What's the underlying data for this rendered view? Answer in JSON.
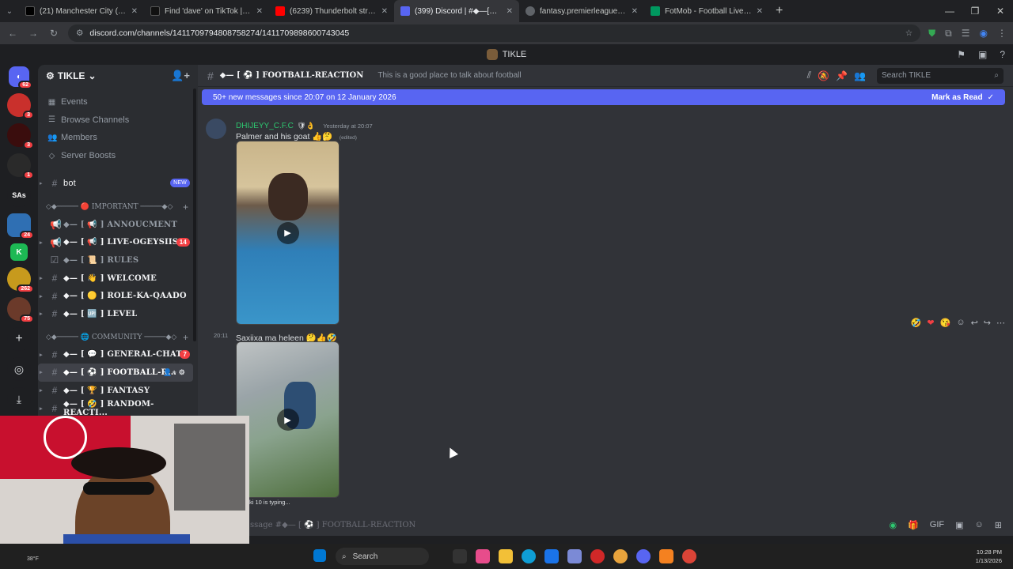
{
  "browser": {
    "tabs": [
      {
        "title": "(21) Manchester City (@ManCity...",
        "color": "#000000",
        "icon": "x-icon"
      },
      {
        "title": "Find 'dave' on TikTok | TikTok Se...",
        "color": "#111111",
        "icon": "tiktok-icon"
      },
      {
        "title": "(6239) Thunderbolt strikes seal...",
        "color": "#ff0000",
        "icon": "youtube-icon"
      },
      {
        "title": "(399) Discord | #◆—[⊛]FOOT...",
        "color": "#5865f2",
        "icon": "discord-icon"
      },
      {
        "title": "fantasy.premierleague.com",
        "color": "#37003c",
        "icon": "globe-icon"
      },
      {
        "title": "FotMob - Football Live Scores",
        "color": "#00985f",
        "icon": "fotmob-icon"
      }
    ],
    "url": "discord.com/channels/1411709794808758274/1411709898600743045"
  },
  "discord": {
    "title": "TIKLE",
    "server_name": "TIKLE",
    "nav": [
      "Events",
      "Browse Channels",
      "Members",
      "Server Boosts"
    ],
    "bot_channel": {
      "name": "bot",
      "badge": "NEW"
    },
    "cat_important": "◇◆───── 🔴 IMPORTANT ─────◆◇",
    "channels_important": [
      {
        "name": "◆— [ 📢 ] ANNOUCMENT",
        "unread": false,
        "count": ""
      },
      {
        "name": "◆— [ 📢 ] LIVE-OGEYSIIS",
        "unread": true,
        "count": "14"
      },
      {
        "name": "◆— [ 📜 ] RULES",
        "unread": false,
        "count": ""
      },
      {
        "name": "◆— [ 👋 ] WELCOME",
        "unread": true,
        "count": ""
      },
      {
        "name": "◆— [ 🟡 ] ROLE-KA-QAADO",
        "unread": true,
        "count": ""
      },
      {
        "name": "◆— [ 🆙 ] LEVEL",
        "unread": true,
        "count": ""
      }
    ],
    "cat_community": "◇◆───── 🌐 COMMUNITY ─────◆◇",
    "channels_community": [
      {
        "name": "◆— [ 💬 ] GENERAL-CHAT",
        "unread": true,
        "count": "7"
      },
      {
        "name": "◆— [ ⚽ ] FOOTBALL-R...",
        "active": true
      },
      {
        "name": "◆— [ 🏆 ] FANTASY",
        "unread": true
      },
      {
        "name": "◆— [ 🤣 ] RANDOM-REACTI...",
        "unread": true
      }
    ],
    "channel_header": {
      "name": "◆— [ ⚽ ] FOOTBALL-REACTION",
      "topic": "This is a good place to talk about football",
      "search_placeholder": "Search TIKLE"
    },
    "new_messages_bar": {
      "text": "50+ new messages since 20:07 on 12 January 2026",
      "action": "Mark as Read"
    },
    "messages": [
      {
        "author": "DHIJEYY_C.F.C",
        "timestamp": "Yesterday at 20:07",
        "text": "Palmer and his goat 👍🤔",
        "edited": "(edited)"
      },
      {
        "time": "20:11",
        "text": "Saxiixa ma heleen 🤔👍🤣"
      }
    ],
    "typing": "ki 10 is typing...",
    "composer_placeholder": "ssage #◆— [ ⚽ ] FOOTBALL-REACTION",
    "server_badges": [
      "62",
      "3",
      "3",
      "1",
      "24",
      "262",
      "75"
    ],
    "server_text": "SAs"
  },
  "taskbar": {
    "search": "Search",
    "time": "10:28 PM",
    "date": "1/13/2026",
    "weather": "38°F"
  },
  "colors": {
    "accent": "#5865f2",
    "username": "#2dc770",
    "badge": "#f23f43"
  }
}
